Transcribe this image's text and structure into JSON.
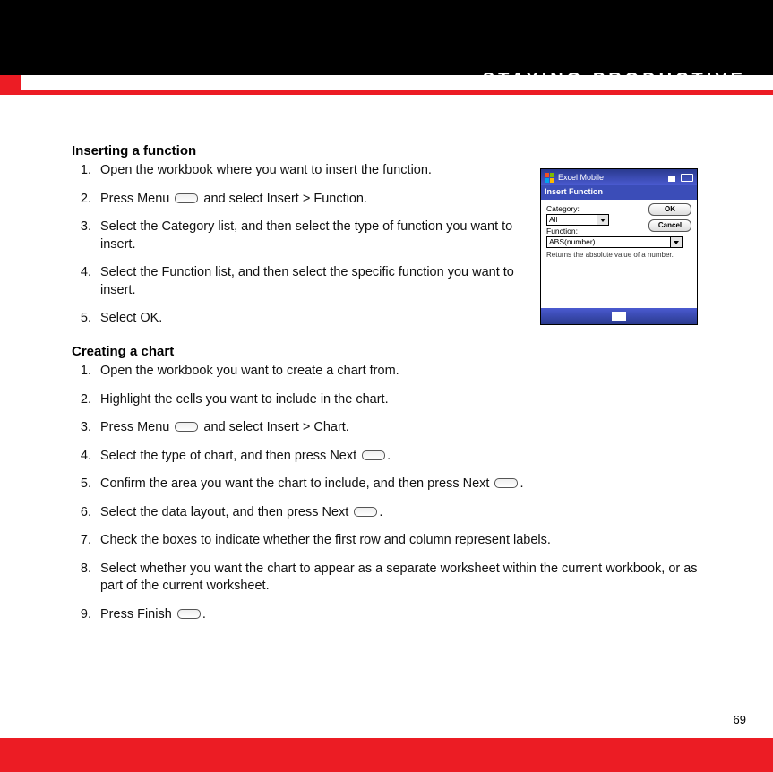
{
  "chapter_title": "STAYING PRODUCTIVE",
  "page_number": "69",
  "section1": {
    "title": "Inserting a function",
    "s1": "Open the workbook where you want to insert the function.",
    "s2a": "Press Menu ",
    "s2b": " and select Insert > Function.",
    "s3": "Select the Category list, and then select the type of function you want to insert.",
    "s4": "Select the Function list, and then select the specific function you want to insert.",
    "s5": "Select OK."
  },
  "section2": {
    "title": "Creating a chart",
    "s1": "Open the workbook you want to create a chart from.",
    "s2": "Highlight the cells you want to include in the chart.",
    "s3a": "Press Menu ",
    "s3b": " and select Insert > Chart.",
    "s4a": "Select the type of chart, and then press Next ",
    "s4b": ".",
    "s5a": "Confirm the area you want the chart to include, and then press Next ",
    "s5b": ".",
    "s6a": "Select the data layout, and then press Next ",
    "s6b": ".",
    "s7": "Check the boxes to indicate whether the first row and column represent labels.",
    "s8": "Select whether you want the chart to appear as a separate worksheet within the current workbook, or as part of the current worksheet.",
    "s9a": "Press Finish ",
    "s9b": "."
  },
  "device": {
    "app_title": "Excel Mobile",
    "dialog_title": "Insert Function",
    "category_label": "Category:",
    "category_value": "All",
    "function_label": "Function:",
    "function_value": "ABS(number)",
    "help_text": "Returns the absolute value of a number.",
    "ok_label": "OK",
    "cancel_label": "Cancel"
  }
}
